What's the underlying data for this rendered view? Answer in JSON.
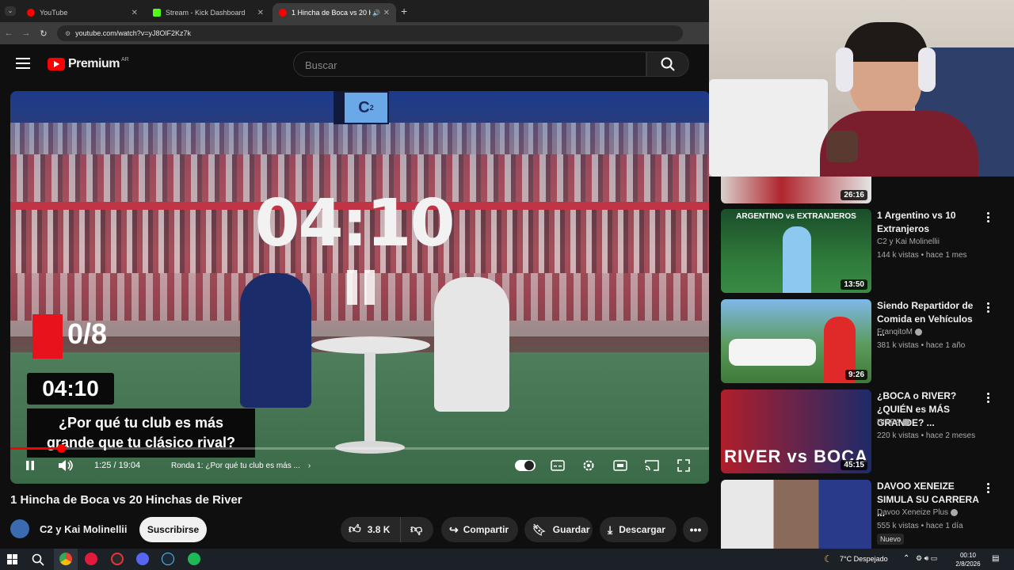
{
  "browser": {
    "tabs": [
      {
        "label": "YouTube",
        "icon": "youtube-icon",
        "color": "#ff0000"
      },
      {
        "label": "Stream - Kick Dashboard",
        "icon": "kick-icon",
        "color": "#53fc18"
      },
      {
        "label": "1 Hincha de Boca vs 20 Hin",
        "icon": "youtube-icon",
        "color": "#ff0000"
      }
    ],
    "url": "youtube.com/watch?v=yJ8OlF2Kz7k"
  },
  "youtube": {
    "logo_text": "Premium",
    "logo_region": "AR",
    "search_placeholder": "Buscar"
  },
  "video_overlay": {
    "badge": "C",
    "badge_sup": "2",
    "big_timer": "04:10",
    "score": "0/8",
    "small_timer": "04:10",
    "question_line1": "¿Por qué tu club es más",
    "question_line2": "grande que tu clásico rival?"
  },
  "player": {
    "progress_fraction": 0.073,
    "time": "1:25 / 19:04",
    "chapter": "Ronda 1: ¿Por qué tu club es más ...",
    "accent": "#ff0000"
  },
  "video": {
    "title": "1 Hincha de Boca vs 20 Hinchas de River",
    "channel": "C2 y Kai Molinellii",
    "subscribe_label": "Suscribirse",
    "likes": "3.8 K",
    "share_label": "Compartir",
    "save_label": "Guardar",
    "download_label": "Descargar"
  },
  "recommendations": [
    {
      "partial": true,
      "duration": "26:16"
    },
    {
      "title": "1 Argentino vs 10 Extranjeros",
      "channel": "C2 y Kai Molinellii",
      "meta": "144 k vistas • hace 1 mes",
      "duration": "13:50",
      "thumb_text": "ARGENTINO vs EXTRANJEROS"
    },
    {
      "title": "Siendo Repartidor de Comida en Vehículos ...",
      "channel": "FranqitoM",
      "verified": true,
      "meta": "381 k vistas • hace 1 año",
      "duration": "9:26"
    },
    {
      "title": "¿BOCA o RIVER? ¿QUIÉN es MÁS GRANDE? ...",
      "channel": "HISPA",
      "verified": true,
      "meta": "220 k vistas • hace 2 meses",
      "duration": "45:15",
      "thumb_text": "RIVER vs BOCA"
    },
    {
      "title": "DAVOO XENEIZE SIMULA SU CARRERA ...",
      "channel": "Davoo Xeneize Plus",
      "verified": true,
      "meta": "555 k vistas • hace 1 día",
      "badge": "Nuevo"
    }
  ],
  "taskbar": {
    "weather": "7°C  Despejado",
    "time": "00:10",
    "date": "2/8/2026"
  }
}
